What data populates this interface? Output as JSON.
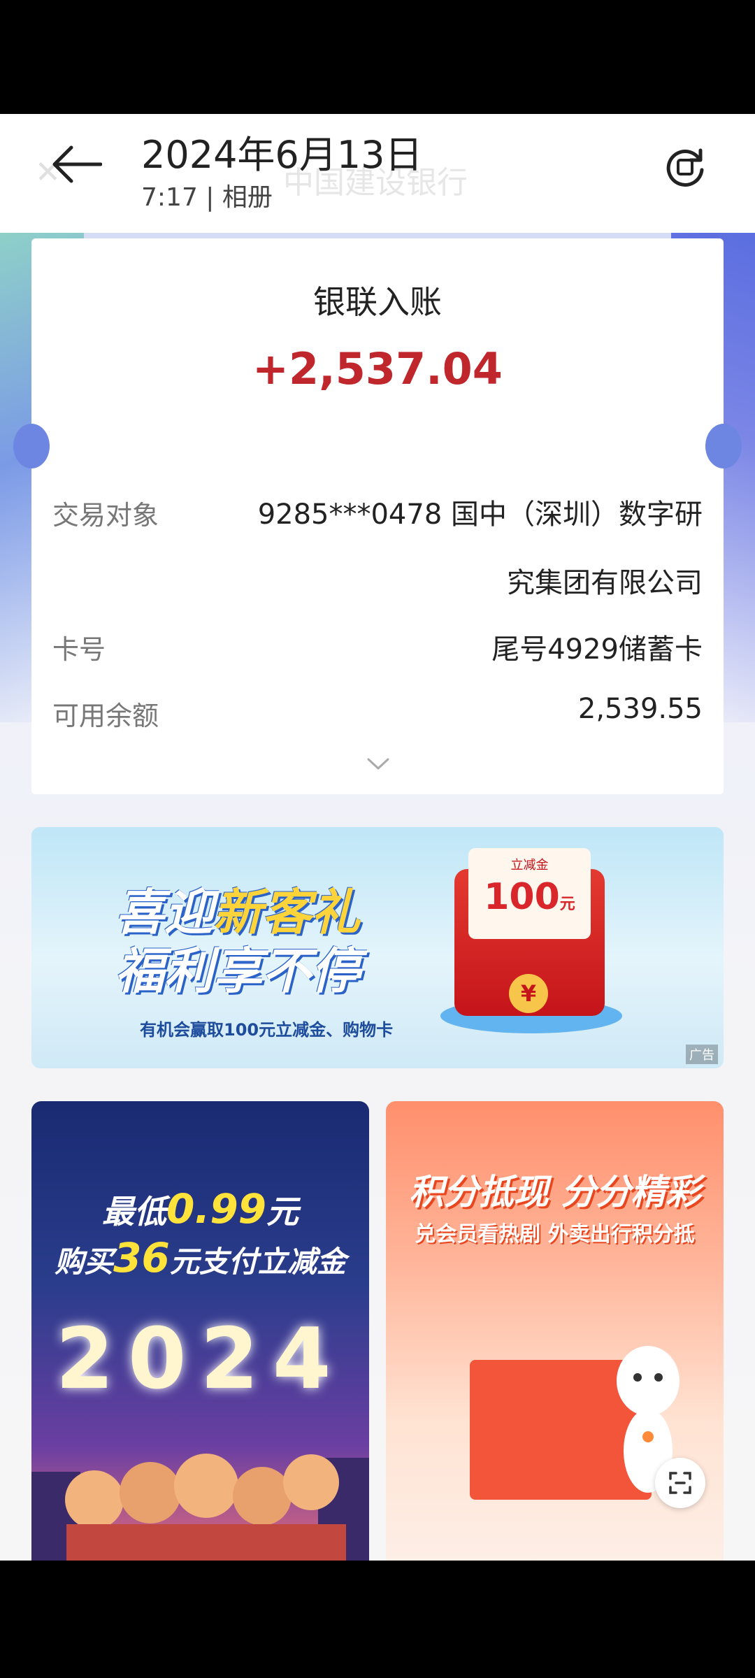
{
  "header": {
    "date_title": "2024年6月13日",
    "subtitle": "7:17 | 相册",
    "background_bank_name": "中国建设银行"
  },
  "transaction_card": {
    "title": "银联入账",
    "amount": "+2,537.04",
    "rows": [
      {
        "label": "交易对象",
        "value_line1": "9285***0478 国中（深圳）数字研",
        "value_line2": "究集团有限公司"
      },
      {
        "label": "卡号",
        "value": "尾号4929储蓄卡"
      },
      {
        "label": "可用余额",
        "value": "2,539.55"
      }
    ]
  },
  "ad_banner": {
    "line1_a": "喜迎",
    "line1_b": "新客礼",
    "line2": "福利享不停",
    "subtitle": "有机会赢取100元立减金、购物卡",
    "envelope_label": "立减金",
    "envelope_amount": "100",
    "envelope_unit": "元",
    "coin_symbol": "¥",
    "ad_tag": "广告"
  },
  "promo_left": {
    "line1_prefix": "最低",
    "line1_value": "0.99",
    "line1_suffix": "元",
    "line2_prefix": "购买",
    "line2_value": "36",
    "line2_suffix": "元支付立减金",
    "year": "2024"
  },
  "promo_right": {
    "title": "积分抵现 分分精彩",
    "subtitle": "兑会员看热剧 外卖出行积分抵"
  }
}
